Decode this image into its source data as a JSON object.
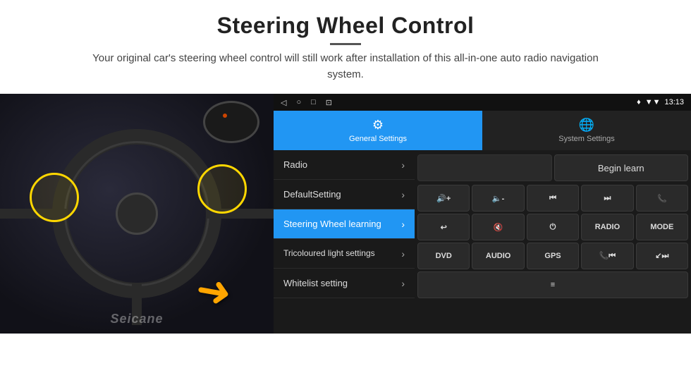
{
  "page": {
    "title": "Steering Wheel Control",
    "subtitle": "Your original car's steering wheel control will still work after installation of this all-in-one auto radio navigation system."
  },
  "status_bar": {
    "time": "13:13",
    "signal_icon": "▼▼",
    "nav_back": "◁",
    "nav_home": "○",
    "nav_square": "□",
    "nav_dot": "⊡"
  },
  "tabs": [
    {
      "id": "general",
      "label": "General Settings",
      "icon": "⚙",
      "active": true
    },
    {
      "id": "system",
      "label": "System Settings",
      "icon": "🌐",
      "active": false
    }
  ],
  "menu_items": [
    {
      "id": "radio",
      "label": "Radio",
      "active": false
    },
    {
      "id": "default",
      "label": "DefaultSetting",
      "active": false
    },
    {
      "id": "steering",
      "label": "Steering Wheel learning",
      "active": true
    },
    {
      "id": "tricoloured",
      "label": "Tricoloured light settings",
      "active": false
    },
    {
      "id": "whitelist",
      "label": "Whitelist setting",
      "active": false
    }
  ],
  "right_panel": {
    "begin_learn_label": "Begin learn",
    "rows": [
      [
        {
          "id": "vol_up",
          "label": "🔊+",
          "unicode": "🔊+"
        },
        {
          "id": "vol_down",
          "label": "🔇-",
          "unicode": "🔈-"
        },
        {
          "id": "prev_track",
          "label": "⏮",
          "unicode": "⏮"
        },
        {
          "id": "next_track",
          "label": "⏭",
          "unicode": "⏭"
        },
        {
          "id": "phone",
          "label": "📞",
          "unicode": "📞"
        }
      ],
      [
        {
          "id": "call_end",
          "label": "↩",
          "unicode": "↩"
        },
        {
          "id": "mute",
          "label": "🔇×",
          "unicode": "🔇"
        },
        {
          "id": "power",
          "label": "⏻",
          "unicode": "⏻"
        },
        {
          "id": "radio_btn",
          "label": "RADIO",
          "unicode": "RADIO"
        },
        {
          "id": "mode",
          "label": "MODE",
          "unicode": "MODE"
        }
      ],
      [
        {
          "id": "dvd",
          "label": "DVD",
          "unicode": "DVD"
        },
        {
          "id": "audio",
          "label": "AUDIO",
          "unicode": "AUDIO"
        },
        {
          "id": "gps",
          "label": "GPS",
          "unicode": "GPS"
        },
        {
          "id": "tel_prev",
          "label": "📞⏮",
          "unicode": "📞⏮"
        },
        {
          "id": "tel_next",
          "label": "↙⏭",
          "unicode": "↙⏭"
        }
      ],
      [
        {
          "id": "eq",
          "label": "≡",
          "unicode": "≡"
        }
      ]
    ]
  },
  "watermark": "Seicane",
  "arrow": "➜"
}
